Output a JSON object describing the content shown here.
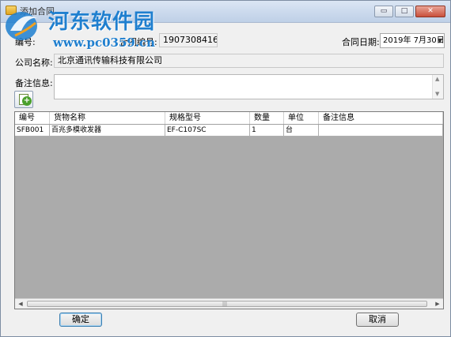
{
  "window": {
    "title": "添加合同",
    "controls": {
      "minimize": "▭",
      "maximize": "□",
      "close": "✕"
    }
  },
  "watermark": {
    "site_name": "河东软件园",
    "url": "www.pc0359.cn"
  },
  "form": {
    "contract_id_label": "合同编号:",
    "contract_id_value": "1907308416",
    "customer_id_label": "编号:",
    "contract_date_label": "合同日期:",
    "contract_date_value": "2019年  7月30日",
    "company_label": "公司名称:",
    "company_value": "北京通讯传输科技有限公司",
    "memo_label": "备注信息:",
    "memo_value": ""
  },
  "grid": {
    "columns": [
      "编号",
      "货物名称",
      "规格型号",
      "数量",
      "单位",
      "备注信息"
    ],
    "rows": [
      {
        "id": "SFB001",
        "name": "百兆多模收发器",
        "model": "EF-C107SC",
        "qty": "1",
        "unit": "台",
        "note": ""
      }
    ]
  },
  "buttons": {
    "ok": "确定",
    "cancel": "取消"
  },
  "icons": {
    "app": "app-icon",
    "add_item": "add-item-icon"
  },
  "colors": {
    "watermark": "#1f7fcf",
    "grid_background": "#ababab"
  }
}
